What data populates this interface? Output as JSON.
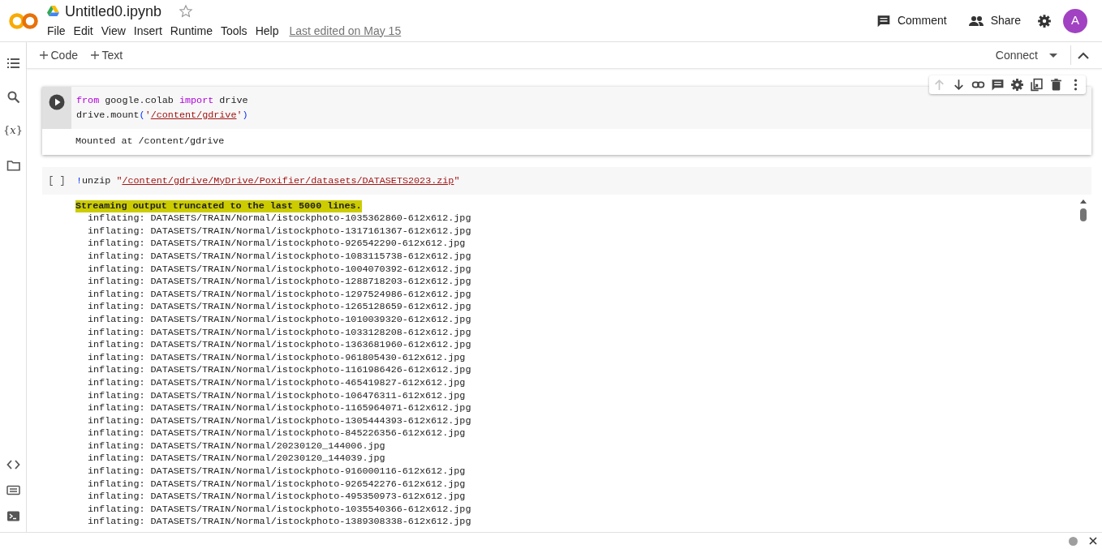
{
  "app": {
    "title": "Untitled0.ipynb",
    "starred": false,
    "menu": [
      "File",
      "Edit",
      "View",
      "Insert",
      "Runtime",
      "Tools",
      "Help"
    ],
    "last_edited": "Last edited on May 15"
  },
  "header_actions": [
    {
      "kind": "comment",
      "label": "Comment"
    },
    {
      "kind": "share",
      "label": "Share"
    },
    {
      "kind": "settings"
    }
  ],
  "avatar": {
    "initial": "A"
  },
  "sidebar": [
    {
      "kind": "toc"
    },
    {
      "kind": "search"
    },
    {
      "kind": "variables",
      "label": "{*x*}"
    },
    {
      "kind": "files"
    }
  ],
  "sidebar_bottom": [
    {
      "kind": "code"
    },
    {
      "kind": "command"
    },
    {
      "kind": "terminal"
    }
  ],
  "toolbar": {
    "add": [
      "Code",
      "Text"
    ],
    "connect": "Connect"
  },
  "cell_toolbar": [
    {
      "kind": "up",
      "disabled": true
    },
    {
      "kind": "down",
      "disabled": false
    },
    {
      "kind": "link",
      "disabled": false
    },
    {
      "kind": "comment",
      "disabled": false
    },
    {
      "kind": "settings",
      "disabled": false
    },
    {
      "kind": "mirror",
      "disabled": false
    },
    {
      "kind": "delete",
      "disabled": false
    },
    {
      "kind": "more",
      "disabled": false
    }
  ],
  "cells": [
    {
      "selected": true,
      "code": [
        [
          {
            "kind": "keyword",
            "text": "from"
          },
          {
            "kind": "plain",
            "text": " google.colab "
          },
          {
            "kind": "keyword",
            "text": "import"
          },
          {
            "kind": "plain",
            "text": " drive"
          }
        ],
        [
          {
            "kind": "plain",
            "text": "drive.mount"
          },
          {
            "kind": "punct",
            "text": "("
          },
          {
            "kind": "string",
            "text": "'"
          },
          {
            "kind": "link",
            "text": "/content/gdrive"
          },
          {
            "kind": "string",
            "text": "'"
          },
          {
            "kind": "punct",
            "text": ")"
          }
        ]
      ],
      "output": [
        {
          "kind": "plain",
          "text": "Mounted at /content/gdrive"
        }
      ]
    },
    {
      "selected": false,
      "prompt": "[ ]",
      "code": [
        [
          {
            "kind": "punct",
            "text": "!"
          },
          {
            "kind": "plain",
            "text": "unzip "
          },
          {
            "kind": "string",
            "text": "\""
          },
          {
            "kind": "link",
            "text": "/content/gdrive/MyDrive/Poxifier/datasets/DATASETS2023.zip"
          },
          {
            "kind": "string",
            "text": "\""
          }
        ]
      ],
      "output": [
        {
          "kind": "warning",
          "text": "Streaming output truncated to the last 5000 lines."
        },
        {
          "kind": "indented",
          "text": "inflating: DATASETS/TRAIN/Normal/istockphoto-1035362860-612x612.jpg"
        },
        {
          "kind": "indented",
          "text": "inflating: DATASETS/TRAIN/Normal/istockphoto-1317161367-612x612.jpg"
        },
        {
          "kind": "indented",
          "text": "inflating: DATASETS/TRAIN/Normal/istockphoto-926542290-612x612.jpg"
        },
        {
          "kind": "indented",
          "text": "inflating: DATASETS/TRAIN/Normal/istockphoto-1083115738-612x612.jpg"
        },
        {
          "kind": "indented",
          "text": "inflating: DATASETS/TRAIN/Normal/istockphoto-1004070392-612x612.jpg"
        },
        {
          "kind": "indented",
          "text": "inflating: DATASETS/TRAIN/Normal/istockphoto-1288718203-612x612.jpg"
        },
        {
          "kind": "indented",
          "text": "inflating: DATASETS/TRAIN/Normal/istockphoto-1297524986-612x612.jpg"
        },
        {
          "kind": "indented",
          "text": "inflating: DATASETS/TRAIN/Normal/istockphoto-1265128659-612x612.jpg"
        },
        {
          "kind": "indented",
          "text": "inflating: DATASETS/TRAIN/Normal/istockphoto-1010039320-612x612.jpg"
        },
        {
          "kind": "indented",
          "text": "inflating: DATASETS/TRAIN/Normal/istockphoto-1033128208-612x612.jpg"
        },
        {
          "kind": "indented",
          "text": "inflating: DATASETS/TRAIN/Normal/istockphoto-1363681960-612x612.jpg"
        },
        {
          "kind": "indented",
          "text": "inflating: DATASETS/TRAIN/Normal/istockphoto-961805430-612x612.jpg"
        },
        {
          "kind": "indented",
          "text": "inflating: DATASETS/TRAIN/Normal/istockphoto-1161986426-612x612.jpg"
        },
        {
          "kind": "indented",
          "text": "inflating: DATASETS/TRAIN/Normal/istockphoto-465419827-612x612.jpg"
        },
        {
          "kind": "indented",
          "text": "inflating: DATASETS/TRAIN/Normal/istockphoto-106476311-612x612.jpg"
        },
        {
          "kind": "indented",
          "text": "inflating: DATASETS/TRAIN/Normal/istockphoto-1165964071-612x612.jpg"
        },
        {
          "kind": "indented",
          "text": "inflating: DATASETS/TRAIN/Normal/istockphoto-1305444393-612x612.jpg"
        },
        {
          "kind": "indented",
          "text": "inflating: DATASETS/TRAIN/Normal/istockphoto-845226356-612x612.jpg"
        },
        {
          "kind": "indented",
          "text": "inflating: DATASETS/TRAIN/Normal/20230120_144006.jpg"
        },
        {
          "kind": "indented",
          "text": "inflating: DATASETS/TRAIN/Normal/20230120_144039.jpg"
        },
        {
          "kind": "indented",
          "text": "inflating: DATASETS/TRAIN/Normal/istockphoto-916000116-612x612.jpg"
        },
        {
          "kind": "indented",
          "text": "inflating: DATASETS/TRAIN/Normal/istockphoto-926542276-612x612.jpg"
        },
        {
          "kind": "indented",
          "text": "inflating: DATASETS/TRAIN/Normal/istockphoto-495350973-612x612.jpg"
        },
        {
          "kind": "indented",
          "text": "inflating: DATASETS/TRAIN/Normal/istockphoto-1035540366-612x612.jpg"
        },
        {
          "kind": "indented",
          "text": "inflating: DATASETS/TRAIN/Normal/istockphoto-1389308338-612x612.jpg"
        }
      ]
    }
  ]
}
